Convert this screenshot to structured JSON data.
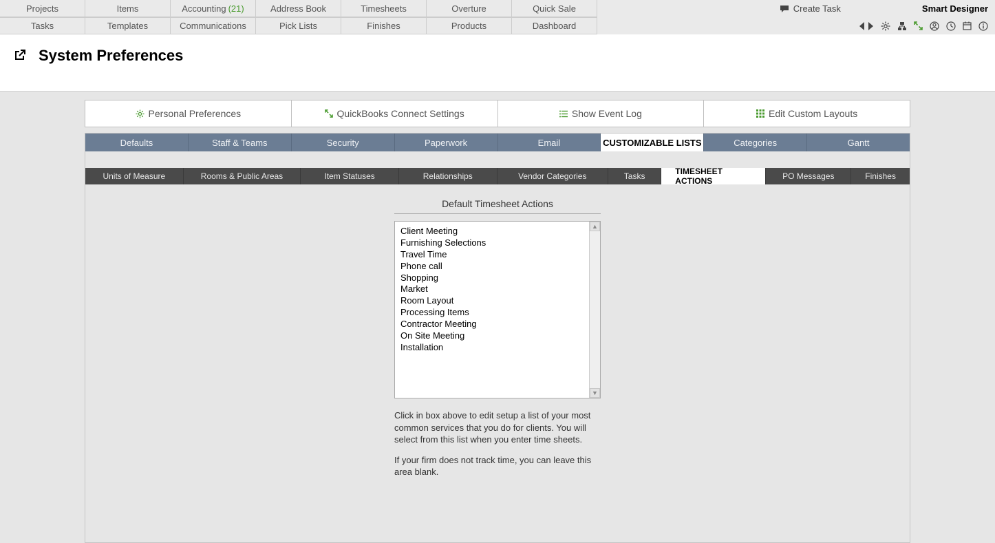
{
  "topnav": {
    "row1": [
      {
        "label": "Projects"
      },
      {
        "label": "Items"
      },
      {
        "label": "Accounting",
        "badge": "(21)"
      },
      {
        "label": "Address Book"
      },
      {
        "label": "Timesheets"
      },
      {
        "label": "Overture"
      },
      {
        "label": "Quick Sale"
      }
    ],
    "row2": [
      {
        "label": "Tasks"
      },
      {
        "label": "Templates"
      },
      {
        "label": "Communications"
      },
      {
        "label": "Pick Lists"
      },
      {
        "label": "Finishes"
      },
      {
        "label": "Products"
      },
      {
        "label": "Dashboard"
      }
    ],
    "create_task": "Create Task",
    "brand": "Smart Designer"
  },
  "page": {
    "title": "System Preferences"
  },
  "actions": [
    {
      "label": "Personal Preferences",
      "icon": "gear",
      "color": "#4a9b2f"
    },
    {
      "label": "QuickBooks Connect Settings",
      "icon": "expand",
      "color": "#4a9b2f"
    },
    {
      "label": "Show Event Log",
      "icon": "list",
      "color": "#4a9b2f"
    },
    {
      "label": "Edit Custom Layouts",
      "icon": "grid",
      "color": "#4a9b2f"
    }
  ],
  "tabs_primary": [
    {
      "label": "Defaults"
    },
    {
      "label": "Staff & Teams"
    },
    {
      "label": "Security"
    },
    {
      "label": "Paperwork"
    },
    {
      "label": "Email"
    },
    {
      "label": "CUSTOMIZABLE LISTS",
      "active": true
    },
    {
      "label": "Categories"
    },
    {
      "label": "Gantt"
    }
  ],
  "tabs_secondary": [
    {
      "label": "Units of Measure"
    },
    {
      "label": "Rooms & Public Areas"
    },
    {
      "label": "Item Statuses"
    },
    {
      "label": "Relationships"
    },
    {
      "label": "Vendor Categories"
    },
    {
      "label": "Tasks"
    },
    {
      "label": "TIMESHEET ACTIONS",
      "active": true
    },
    {
      "label": "PO Messages"
    },
    {
      "label": "Finishes"
    }
  ],
  "panel": {
    "heading": "Default Timesheet Actions",
    "items": [
      "Client Meeting",
      "Furnishing Selections",
      "Travel Time",
      "Phone call",
      "Shopping",
      "Market",
      "Room Layout",
      "Processing Items",
      "Contractor Meeting",
      "On Site Meeting",
      "Installation"
    ],
    "help1": "Click in box above to edit setup a list of your most common services that you do for clients. You will select from this list when you enter time sheets.",
    "help2": "If your firm does not track time, you can leave this area blank."
  }
}
